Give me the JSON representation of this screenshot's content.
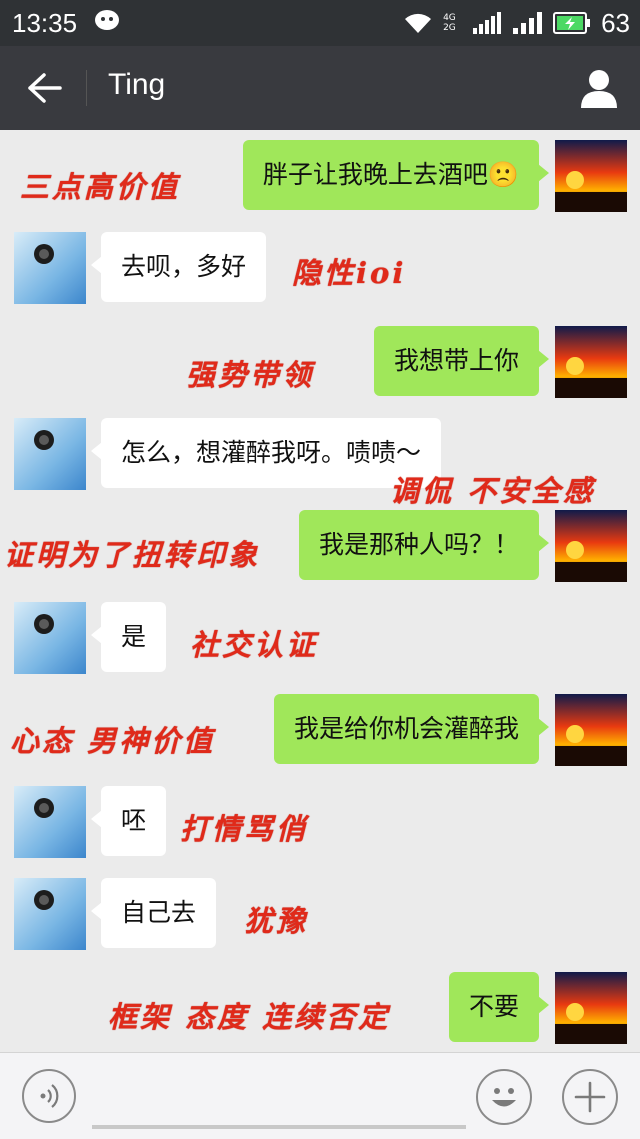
{
  "status_bar": {
    "time": "13:35",
    "network": "4G 2G",
    "battery": "63"
  },
  "header": {
    "title": "Ting"
  },
  "messages": [
    {
      "side": "mine",
      "text": "胖子让我晚上去酒吧🙁",
      "note": "三点高价值"
    },
    {
      "side": "theirs",
      "text": "去呗，多好",
      "note": "隐性ioi"
    },
    {
      "side": "mine",
      "text": "我想带上你",
      "note": "强势带领"
    },
    {
      "side": "theirs",
      "text": "怎么，想灌醉我呀。啧啧～",
      "note": "调侃 不安全感"
    },
    {
      "side": "mine",
      "text": "我是那种人吗？！",
      "note": "证明为了扭转印象"
    },
    {
      "side": "theirs",
      "text": "是",
      "note": "社交认证"
    },
    {
      "side": "mine",
      "text": "我是给你机会灌醉我",
      "note": "心态 男神价值"
    },
    {
      "side": "theirs",
      "text": "呸",
      "note": "打情骂俏"
    },
    {
      "side": "theirs",
      "text": "自己去",
      "note": "犹豫"
    },
    {
      "side": "mine",
      "text": "不要",
      "note": "框架 态度 连续否定"
    }
  ],
  "colors": {
    "my_bubble": "#a0e75a",
    "their_bubble": "#ffffff",
    "annotation": "#e02a1a",
    "nav_bg": "#393a3f"
  }
}
